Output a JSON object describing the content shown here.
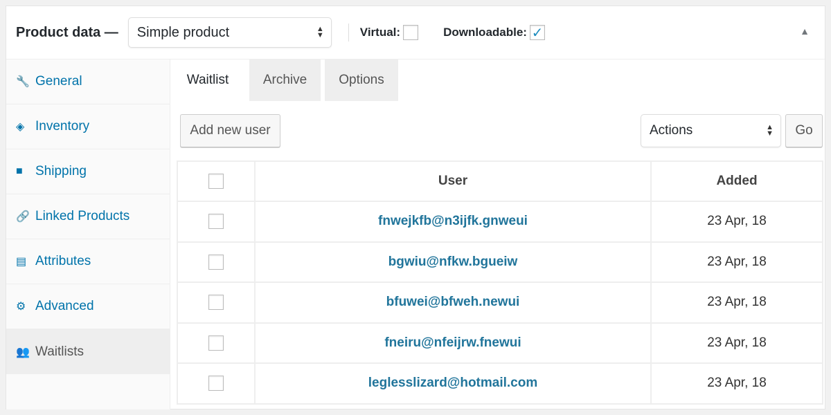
{
  "header": {
    "title": "Product data —",
    "product_type": "Simple product",
    "virtual_label": "Virtual:",
    "virtual_checked": false,
    "downloadable_label": "Downloadable:",
    "downloadable_checked": true,
    "check_glyph": "✓",
    "collapse_glyph": "▲"
  },
  "sidebar": {
    "items": [
      {
        "label": "General",
        "icon": "wrench-icon",
        "glyph": "🔧"
      },
      {
        "label": "Inventory",
        "icon": "tag-icon",
        "glyph": "◈"
      },
      {
        "label": "Shipping",
        "icon": "truck-icon",
        "glyph": "■"
      },
      {
        "label": "Linked Products",
        "icon": "link-icon",
        "glyph": "🔗"
      },
      {
        "label": "Attributes",
        "icon": "list-icon",
        "glyph": "▤"
      },
      {
        "label": "Advanced",
        "icon": "gear-icon",
        "glyph": "⚙"
      },
      {
        "label": "Waitlists",
        "icon": "users-icon",
        "glyph": "👥",
        "active": true
      }
    ]
  },
  "tabs": [
    {
      "label": "Waitlist",
      "active": true
    },
    {
      "label": "Archive"
    },
    {
      "label": "Options"
    }
  ],
  "toolbar": {
    "add_user": "Add new user",
    "actions": "Actions",
    "go": "Go"
  },
  "table": {
    "headers": [
      "User",
      "Added"
    ],
    "rows": [
      {
        "user": "fnwejkfb@n3ijfk.gnweui",
        "added": "23 Apr, 18"
      },
      {
        "user": "bgwiu@nfkw.bgueiw",
        "added": "23 Apr, 18"
      },
      {
        "user": "bfuwei@bfweh.newui",
        "added": "23 Apr, 18"
      },
      {
        "user": "fneiru@nfeijrw.fnewui",
        "added": "23 Apr, 18"
      },
      {
        "user": "leglesslizard@hotmail.com",
        "added": "23 Apr, 18"
      }
    ]
  },
  "colors": {
    "link": "#0073aa",
    "email": "#21759b"
  }
}
